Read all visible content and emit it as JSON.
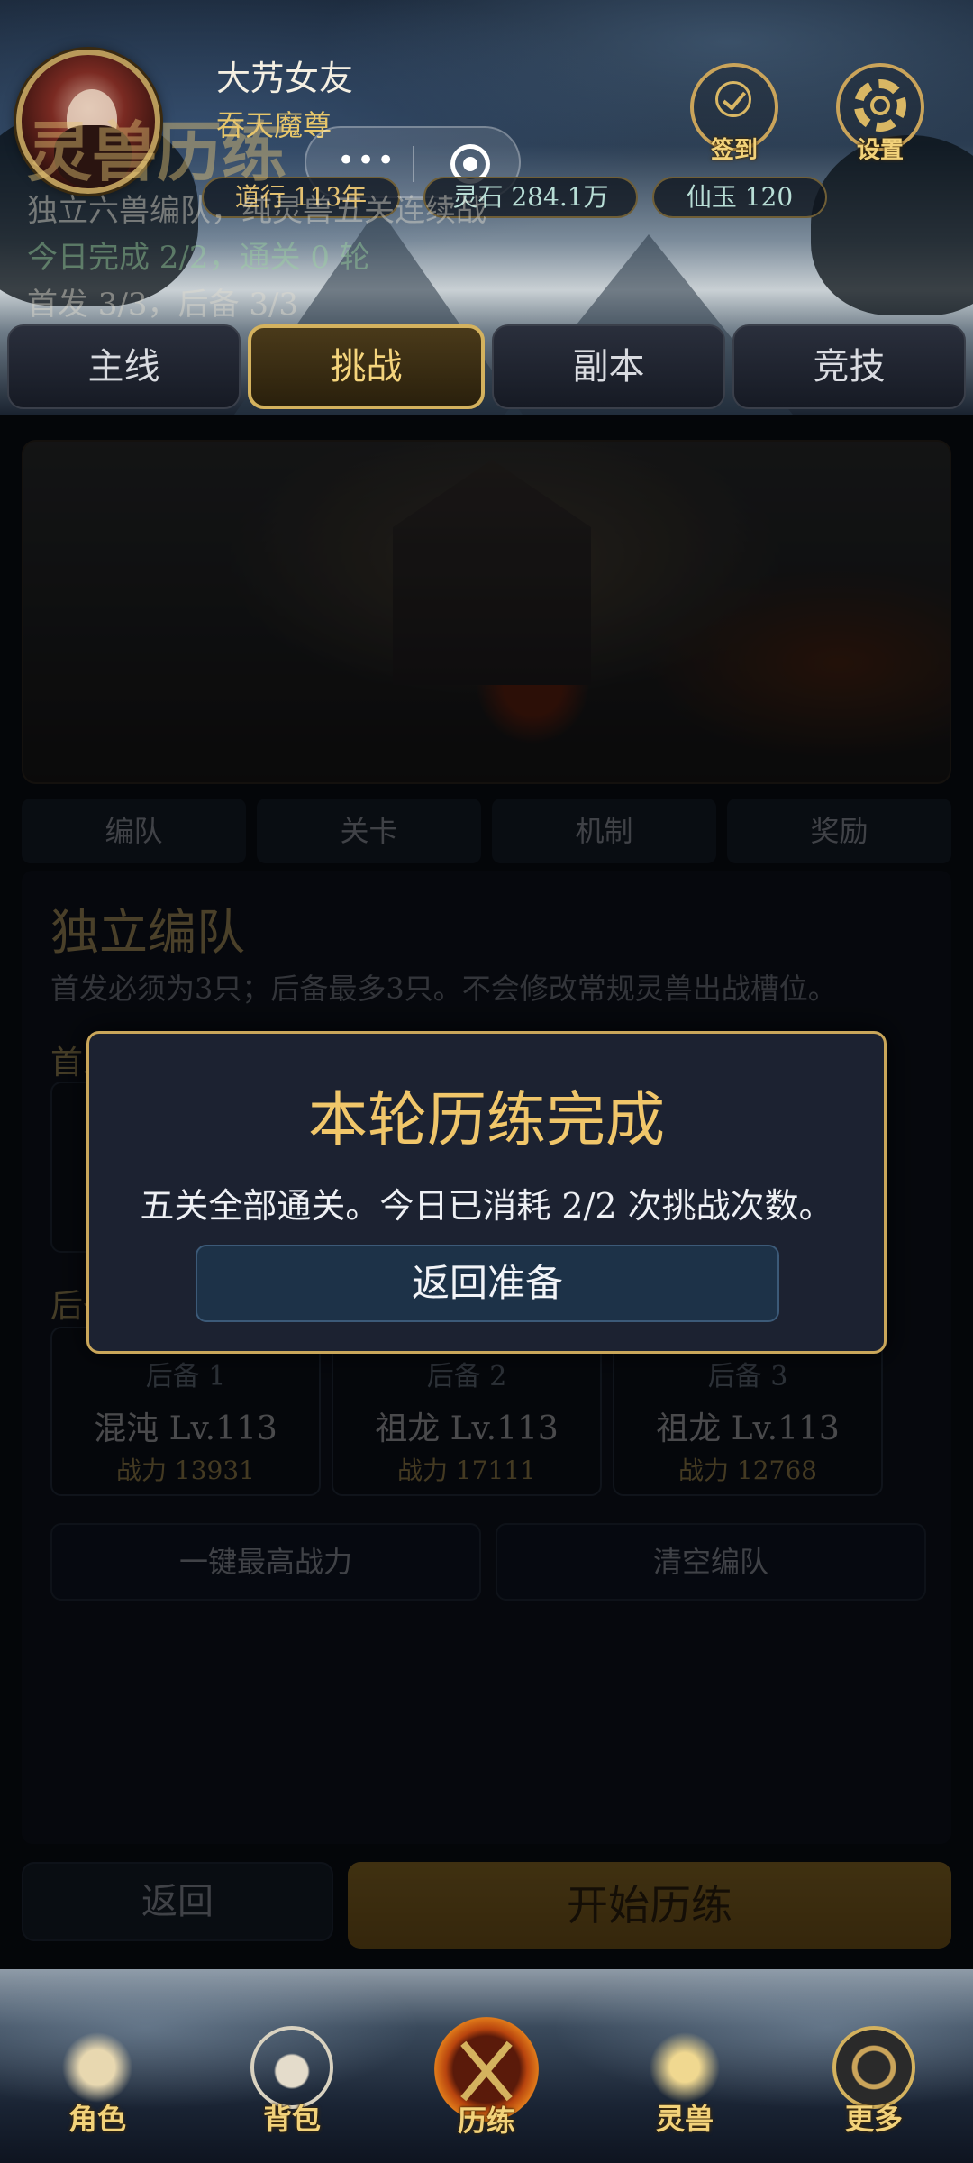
{
  "header": {
    "player_name": "大艿女友",
    "player_title": "吞天魔尊",
    "stats": {
      "dao": "道行 113年",
      "spirit_stone": "灵石 284.1万",
      "jade": "仙玉 120"
    },
    "checkin_label": "签到",
    "settings_label": "设置",
    "capsule_more": "•••"
  },
  "tabs": [
    {
      "label": "主线",
      "active": false
    },
    {
      "label": "挑战",
      "active": true
    },
    {
      "label": "副本",
      "active": false
    },
    {
      "label": "竞技",
      "active": false
    }
  ],
  "banner": {
    "title": "灵兽历练",
    "subtitle": "独立六兽编队，纯灵兽五关连续战",
    "today": "今日完成 2/2，通关 0 轮",
    "count": "首发 3/3，后备 3/3"
  },
  "subtabs": [
    "编队",
    "关卡",
    "机制",
    "奖励"
  ],
  "formation": {
    "title": "独立编队",
    "desc": "首发必须为3只；后备最多3只。不会修改常规灵兽出战槽位。",
    "starter_label": "首发",
    "bench_label": "后备",
    "bench": [
      {
        "tag": "后备 1",
        "name": "混沌 Lv.113",
        "power": "战力 13931"
      },
      {
        "tag": "后备 2",
        "name": "祖龙 Lv.113",
        "power": "战力 17111"
      },
      {
        "tag": "后备 3",
        "name": "祖龙 Lv.113",
        "power": "战力 12768"
      }
    ],
    "auto_button": "一键最高战力",
    "clear_button": "清空编队"
  },
  "footer_actions": {
    "back": "返回",
    "start": "开始历练"
  },
  "modal": {
    "title": "本轮历练完成",
    "text": "五关全部通关。今日已消耗 2/2 次挑战次数。",
    "button": "返回准备"
  },
  "bottom_nav": [
    {
      "label": "角色",
      "icon": "character-icon"
    },
    {
      "label": "背包",
      "icon": "bag-icon"
    },
    {
      "label": "历练",
      "icon": "crossed-swords-icon"
    },
    {
      "label": "灵兽",
      "icon": "dragon-icon"
    },
    {
      "label": "更多",
      "icon": "taiji-icon"
    }
  ],
  "colors": {
    "gold": "#e6c478",
    "modal_bg": "#1c2231",
    "modal_border": "#c9a65a",
    "start_button": "#c6952a"
  }
}
